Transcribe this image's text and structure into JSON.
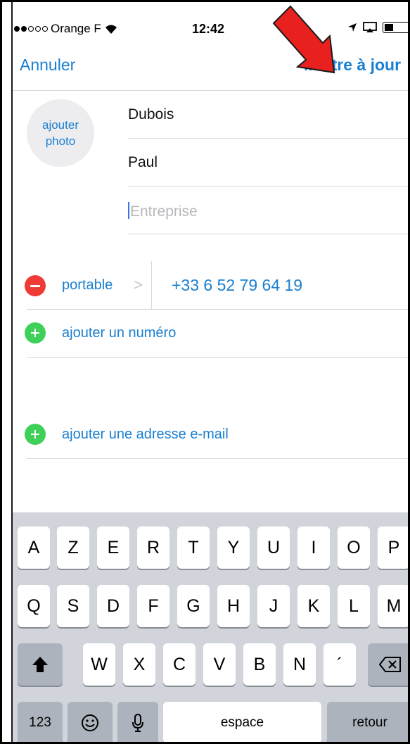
{
  "status_bar": {
    "carrier": "Orange F",
    "time": "12:42"
  },
  "nav": {
    "cancel": "Annuler",
    "update": "Mettre à jour"
  },
  "photo": {
    "line1": "ajouter",
    "line2": "photo"
  },
  "fields": {
    "last_name": "Dubois",
    "first_name": "Paul",
    "company_placeholder": "Entreprise"
  },
  "phone": {
    "label": "portable",
    "chevron": ">",
    "number": "+33 6 52 79 64 19"
  },
  "add_number": "ajouter un numéro",
  "add_email": "ajouter une adresse e-mail",
  "keyboard": {
    "row1": [
      "A",
      "Z",
      "E",
      "R",
      "T",
      "Y",
      "U",
      "I",
      "O",
      "P"
    ],
    "row2": [
      "Q",
      "S",
      "D",
      "F",
      "G",
      "H",
      "J",
      "K",
      "L",
      "M"
    ],
    "row3": [
      "W",
      "X",
      "C",
      "V",
      "B",
      "N",
      "´"
    ],
    "numbers": "123",
    "space": "espace",
    "return": "retour"
  },
  "colors": {
    "accent": "#1a7fd0",
    "delete": "#ee3b35",
    "add": "#3fd05a",
    "annotation_arrow": "#e8201e"
  },
  "icons": {
    "wifi": "wifi-icon",
    "location": "location-arrow-icon",
    "screen_mirror": "screen-mirror-icon",
    "battery": "battery-icon",
    "shift": "shift-arrow-icon",
    "backspace": "backspace-icon",
    "emoji": "emoji-icon",
    "mic": "microphone-icon"
  }
}
